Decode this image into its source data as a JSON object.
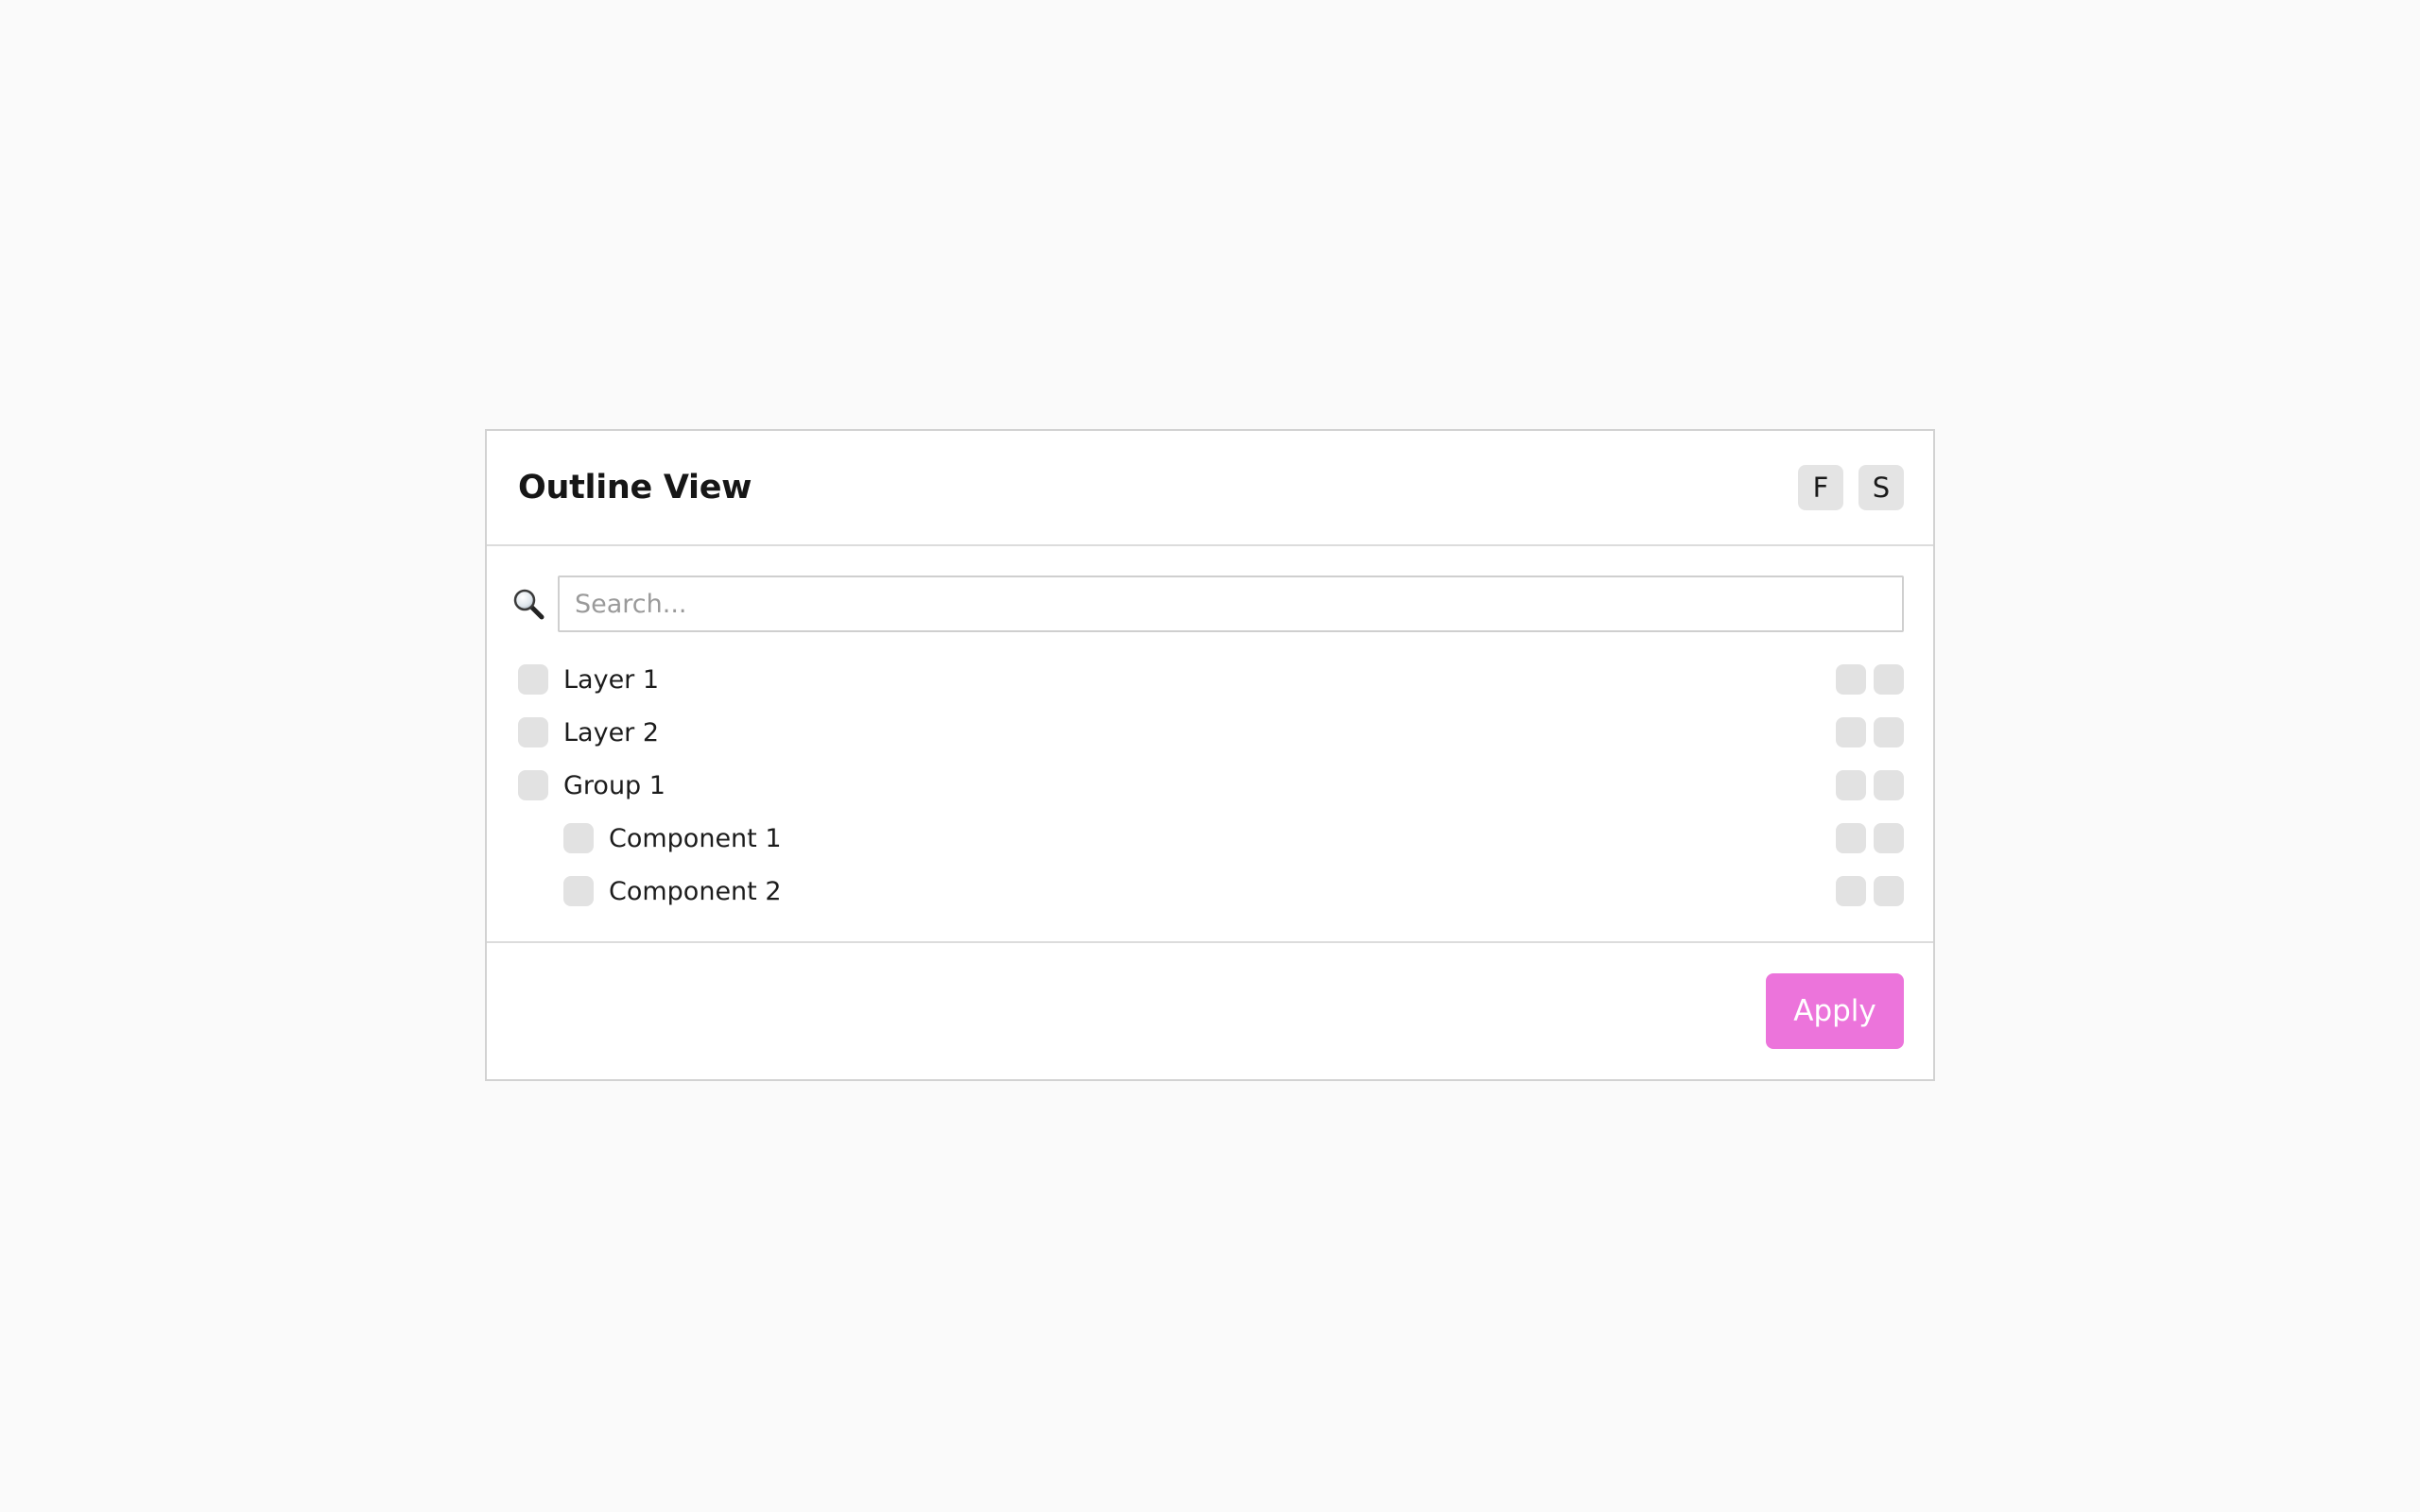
{
  "panel": {
    "title": "Outline View",
    "header_buttons": [
      {
        "label": "F"
      },
      {
        "label": "S"
      }
    ]
  },
  "search": {
    "icon": "magnifier-icon",
    "placeholder": "Search...",
    "value": ""
  },
  "tree": {
    "items": [
      {
        "label": "Layer 1",
        "level": 0
      },
      {
        "label": "Layer 2",
        "level": 0
      },
      {
        "label": "Group 1",
        "level": 0
      },
      {
        "label": "Component 1",
        "level": 1
      },
      {
        "label": "Component 2",
        "level": 1
      }
    ]
  },
  "footer": {
    "apply_label": "Apply"
  },
  "colors": {
    "accent": "#ec74db",
    "background": "#fafafa",
    "panel": "#ffffff",
    "control": "#e2e2e2"
  }
}
